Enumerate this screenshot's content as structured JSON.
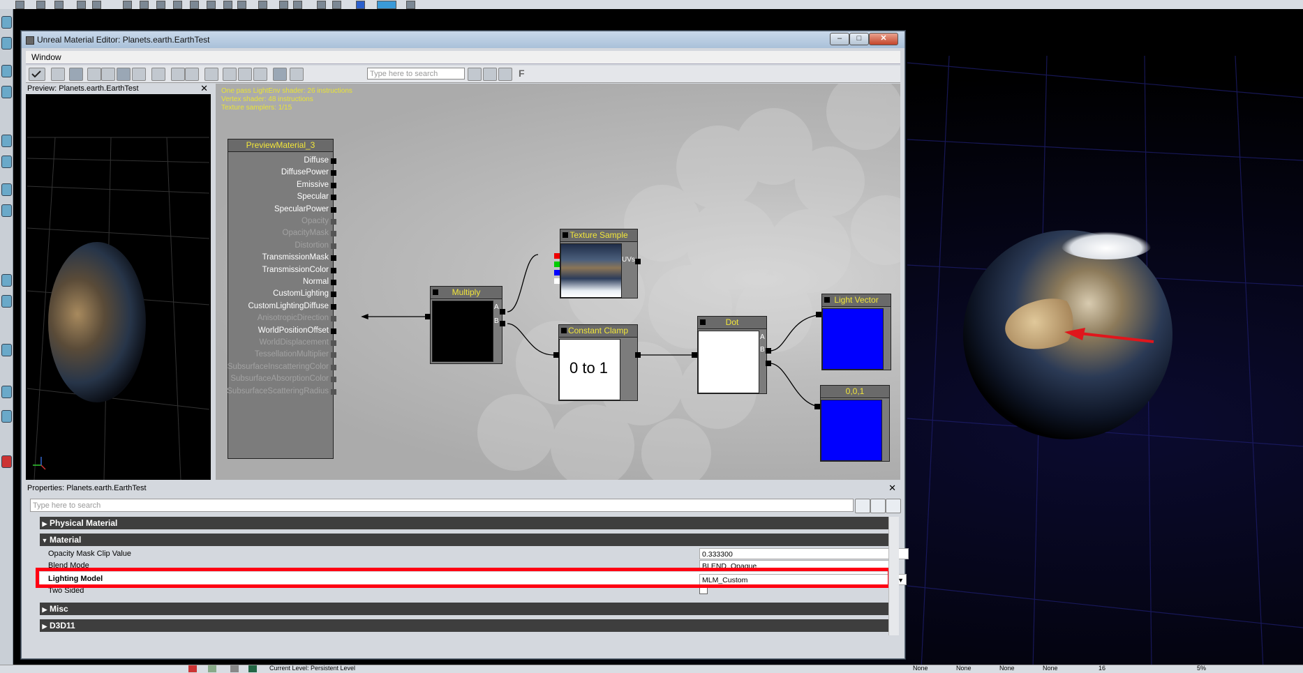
{
  "window": {
    "title": "Unreal Material Editor: Planets.earth.EarthTest",
    "minimize": "‒",
    "maximize": "□",
    "close": "✕"
  },
  "menu": {
    "window": "Window"
  },
  "toolbar": {
    "search_placeholder": "Type here to search",
    "f_label": "F"
  },
  "preview": {
    "title": "Preview: Planets.earth.EarthTest",
    "close": "✕"
  },
  "graph": {
    "stats": [
      "One pass LightEnv shader: 26 instructions",
      "Vertex shader: 48 instructions",
      "Texture samplers: 1/15"
    ],
    "material_node": {
      "title": "PreviewMaterial_3",
      "inputs": [
        {
          "label": "Diffuse",
          "enabled": true
        },
        {
          "label": "DiffusePower",
          "enabled": true
        },
        {
          "label": "Emissive",
          "enabled": true
        },
        {
          "label": "Specular",
          "enabled": true
        },
        {
          "label": "SpecularPower",
          "enabled": true
        },
        {
          "label": "Opacity",
          "enabled": false
        },
        {
          "label": "OpacityMask",
          "enabled": false
        },
        {
          "label": "Distortion",
          "enabled": false
        },
        {
          "label": "TransmissionMask",
          "enabled": true
        },
        {
          "label": "TransmissionColor",
          "enabled": true
        },
        {
          "label": "Normal",
          "enabled": true
        },
        {
          "label": "CustomLighting",
          "enabled": true
        },
        {
          "label": "CustomLightingDiffuse",
          "enabled": true
        },
        {
          "label": "AnisotropicDirection",
          "enabled": false
        },
        {
          "label": "WorldPositionOffset",
          "enabled": true
        },
        {
          "label": "WorldDisplacement",
          "enabled": false
        },
        {
          "label": "TessellationMultiplier",
          "enabled": false
        },
        {
          "label": "SubsurfaceInscatteringColor",
          "enabled": false
        },
        {
          "label": "SubsurfaceAbsorptionColor",
          "enabled": false
        },
        {
          "label": "SubsurfaceScatteringRadius",
          "enabled": false
        }
      ]
    },
    "multiply": {
      "title": "Multiply",
      "a": "A",
      "b": "B"
    },
    "texture_sample": {
      "title": "Texture Sample",
      "uvs": "UVs"
    },
    "constant_clamp": {
      "title": "Constant Clamp",
      "text": "0 to 1"
    },
    "dot": {
      "title": "Dot",
      "a": "A",
      "b": "B"
    },
    "light_vector": {
      "title": "Light Vector",
      "color": "#0000ff"
    },
    "constant_vec": {
      "title": "0,0,1",
      "color": "#0000ff"
    }
  },
  "properties": {
    "title": "Properties: Planets.earth.EarthTest",
    "close": "✕",
    "search_placeholder": "Type here to search",
    "categories": {
      "physical_material": "Physical Material",
      "material": "Material",
      "misc": "Misc",
      "d3d11": "D3D11"
    },
    "rows": {
      "opacity_mask_clip_label": "Opacity Mask Clip Value",
      "opacity_mask_clip_value": "0.333300",
      "blend_mode_label": "Blend Mode",
      "blend_mode_value": "BLEND_Opaque",
      "lighting_model_label": "Lighting Model",
      "lighting_model_value": "MLM_Custom",
      "two_sided_label": "Two Sided"
    },
    "highlight_color": "#ff0012"
  },
  "status": {
    "current_level": "Current Level: Persistent Level",
    "none1": "None",
    "none2": "None",
    "none3": "None",
    "none4": "None",
    "grid": "16",
    "zoom": "5%"
  }
}
